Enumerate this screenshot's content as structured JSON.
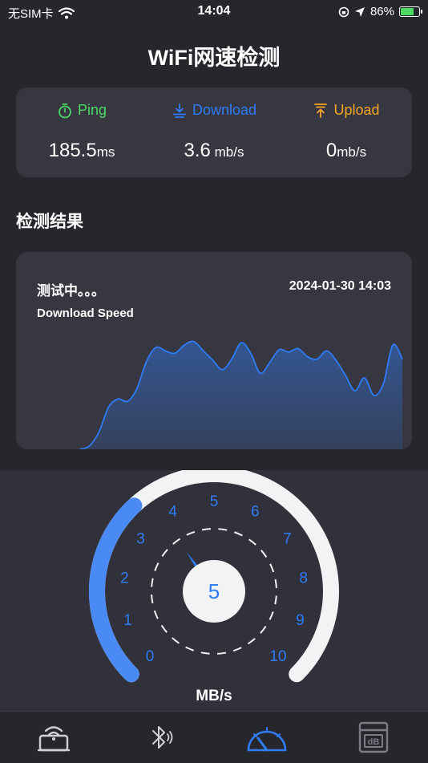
{
  "status_bar": {
    "carrier": "无SIM卡",
    "time": "14:04",
    "battery": "86%"
  },
  "title": "WiFi网速检测",
  "stats": {
    "ping": {
      "label": "Ping",
      "value": "185.5",
      "unit": "ms",
      "color": "#4cd964"
    },
    "download": {
      "label": "Download",
      "value": "3.6",
      "unit": " mb/s",
      "color": "#2f7cf6"
    },
    "upload": {
      "label": "Upload",
      "value": "0",
      "unit": "mb/s",
      "color": "#f5a623"
    }
  },
  "results_title": "检测结果",
  "result_card": {
    "status": "测试中。。。",
    "timestamp": "2024-01-30 14:03",
    "subtitle": "Download Speed"
  },
  "chart_data": {
    "type": "area",
    "title": "Download Speed",
    "values": [
      0,
      0.3,
      1.5,
      3.6,
      4.3,
      4.1,
      5.2,
      7.5,
      8.7,
      8.4,
      8.2,
      8.9,
      9.2,
      8.4,
      7.6,
      6.8,
      7.7,
      9.1,
      8.2,
      6.5,
      7.4,
      8.5,
      8.3,
      8.6,
      7.9,
      7.7,
      8.4,
      7.6,
      6.3,
      5.0,
      6.1,
      4.6,
      5.6,
      8.9,
      7.7
    ],
    "color": "#2f7cf6"
  },
  "gauge": {
    "value": "5",
    "value_num": 5,
    "ticks": [
      "0",
      "1",
      "2",
      "3",
      "4",
      "5",
      "6",
      "7",
      "8",
      "9",
      "10"
    ],
    "unit": "MB/s",
    "accent": "#2f7cf6"
  },
  "tabs": [
    {
      "name": "wifi-router-icon",
      "active": false
    },
    {
      "name": "bluetooth-icon",
      "active": false
    },
    {
      "name": "speedometer-icon",
      "active": true
    },
    {
      "name": "decibel-meter-icon",
      "active": false
    }
  ]
}
